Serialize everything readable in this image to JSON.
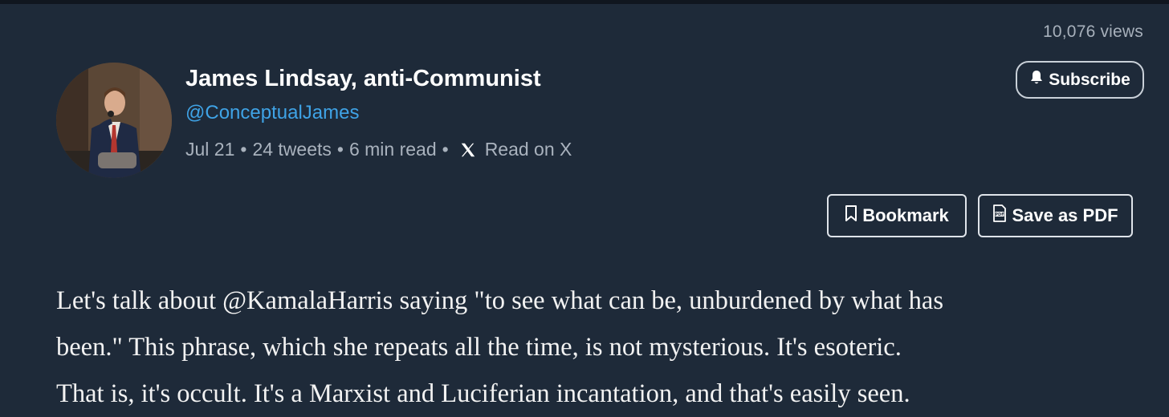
{
  "header": {
    "views": "10,076 views"
  },
  "author": {
    "name": "James Lindsay, anti-Communist",
    "handle": "@ConceptualJames",
    "avatar_icon": "profile-photo"
  },
  "meta": {
    "date": "Jul 21",
    "separator": "•",
    "tweets": "24 tweets",
    "read_time": "6 min read",
    "read_on_x": "Read on X",
    "x_icon": "x-logo-icon"
  },
  "actions": {
    "subscribe_label": "Subscribe",
    "subscribe_icon": "bell-icon",
    "bookmark_label": "Bookmark",
    "bookmark_icon": "bookmark-icon",
    "pdf_label": "Save as PDF",
    "pdf_icon": "pdf-file-icon"
  },
  "content": {
    "lines": [
      "Let's talk about @KamalaHarris saying \"to see what can be, unburdened by what has",
      "been.\" This phrase, which she repeats all the time, is not mysterious. It's esoteric.",
      "That is, it's occult. It's a Marxist and Luciferian incantation, and that's easily seen."
    ]
  },
  "colors": {
    "background": "#1e2a39",
    "handle": "#3fa3e6",
    "muted": "#a9b2bd",
    "text": "#ffffff"
  }
}
